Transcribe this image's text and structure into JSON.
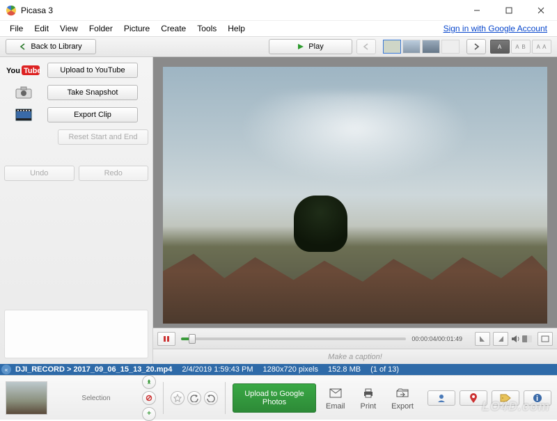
{
  "window": {
    "title": "Picasa 3",
    "sign_in": "Sign in with Google Account"
  },
  "menu": {
    "items": [
      "File",
      "Edit",
      "View",
      "Folder",
      "Picture",
      "Create",
      "Tools",
      "Help"
    ]
  },
  "toolbar": {
    "back_label": "Back to Library",
    "play_label": "Play",
    "ratio": [
      "A",
      "A B",
      "A A"
    ]
  },
  "sidebar": {
    "upload_label": "Upload to YouTube",
    "snapshot_label": "Take Snapshot",
    "export_label": "Export Clip",
    "reset_label": "Reset Start and End",
    "undo_label": "Undo",
    "redo_label": "Redo"
  },
  "player": {
    "time": "00:00:04/00:01:49"
  },
  "caption": {
    "placeholder": "Make a caption!"
  },
  "info": {
    "path": "DJI_RECORD > 2017_09_06_15_13_20.mp4",
    "date": "2/4/2019 1:59:43 PM",
    "dims": "1280x720 pixels",
    "size": "152.8 MB",
    "pos": "(1 of 13)"
  },
  "bottom": {
    "selection_label": "Selection",
    "upload_label": "Upload to Google Photos",
    "email_label": "Email",
    "print_label": "Print",
    "export_label": "Export"
  },
  "watermark": "LO4D.com"
}
